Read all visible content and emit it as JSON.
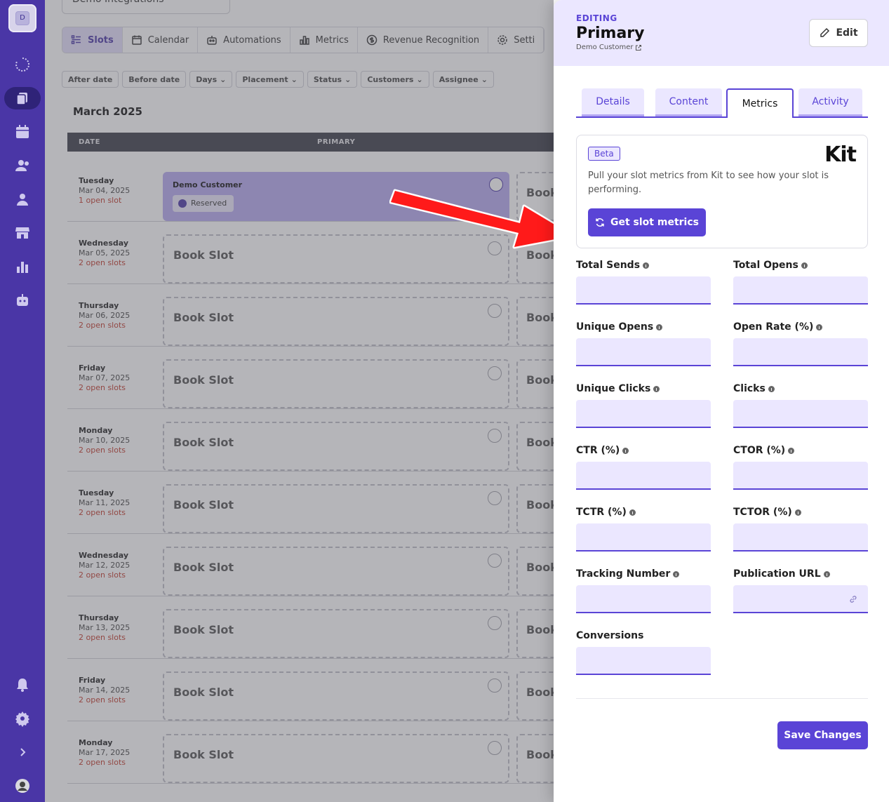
{
  "rail": {
    "logo_letter": "D",
    "icons": [
      "loader-icon",
      "slots-icon",
      "calendar-icon",
      "customers-icon",
      "users-icon",
      "store-icon",
      "metrics-icon",
      "bot-icon",
      "bell-icon",
      "settings-icon",
      "expand-icon",
      "avatar-icon"
    ]
  },
  "background": {
    "integration_select": "Demo Integrations",
    "tabs": [
      "Slots",
      "Calendar",
      "Automations",
      "Metrics",
      "Revenue Recognition",
      "Setti"
    ],
    "filters": [
      "After date",
      "Before date",
      "Days",
      "Placement",
      "Status",
      "Customers",
      "Assignee"
    ],
    "month_title": "March 2025",
    "col_date": "DATE",
    "col_primary": "PRIMARY",
    "rows": [
      {
        "day": "Tuesday",
        "date": "Mar 04, 2025",
        "open": "1 open slot",
        "customer": "Demo Customer",
        "status": "Reserved"
      },
      {
        "day": "Wednesday",
        "date": "Mar 05, 2025",
        "open": "2 open slots"
      },
      {
        "day": "Thursday",
        "date": "Mar 06, 2025",
        "open": "2 open slots"
      },
      {
        "day": "Friday",
        "date": "Mar 07, 2025",
        "open": "2 open slots"
      },
      {
        "day": "Monday",
        "date": "Mar 10, 2025",
        "open": "2 open slots"
      },
      {
        "day": "Tuesday",
        "date": "Mar 11, 2025",
        "open": "2 open slots"
      },
      {
        "day": "Wednesday",
        "date": "Mar 12, 2025",
        "open": "2 open slots"
      },
      {
        "day": "Thursday",
        "date": "Mar 13, 2025",
        "open": "2 open slots"
      },
      {
        "day": "Friday",
        "date": "Mar 14, 2025",
        "open": "2 open slots"
      },
      {
        "day": "Monday",
        "date": "Mar 17, 2025",
        "open": "2 open slots"
      }
    ],
    "book_slot": "Book Slot",
    "book_partial": "Book"
  },
  "panel": {
    "mode": "EDITING",
    "title": "Primary",
    "customer": "Demo Customer",
    "edit_label": "Edit",
    "tabs": [
      "Details",
      "Content",
      "Metrics",
      "Activity"
    ],
    "active_tab": "Metrics",
    "kit": {
      "badge": "Beta",
      "logo": "Kit",
      "description": "Pull your slot metrics from Kit to see how your slot is performing.",
      "button": "Get slot metrics"
    },
    "fields": [
      {
        "label": "Total Sends",
        "value": "",
        "info": true
      },
      {
        "label": "Total Opens",
        "value": "",
        "info": true
      },
      {
        "label": "Unique Opens",
        "value": "",
        "info": true
      },
      {
        "label": "Open Rate (%)",
        "value": "",
        "info": true
      },
      {
        "label": "Unique Clicks",
        "value": "",
        "info": true
      },
      {
        "label": "Clicks",
        "value": "",
        "info": true
      },
      {
        "label": "CTR (%)",
        "value": "",
        "info": true
      },
      {
        "label": "CTOR (%)",
        "value": "",
        "info": true
      },
      {
        "label": "TCTR (%)",
        "value": "",
        "info": true
      },
      {
        "label": "TCTOR (%)",
        "value": "",
        "info": true
      },
      {
        "label": "Tracking Number",
        "value": "",
        "info": true
      },
      {
        "label": "Publication URL",
        "value": "",
        "info": true
      },
      {
        "label": "Conversions",
        "value": "",
        "info": false
      }
    ],
    "save_label": "Save Changes"
  },
  "colors": {
    "accent": "#5a44d6",
    "rail": "#4a36a6",
    "field_bg": "#ebe7ff",
    "arrow": "#ff0000"
  }
}
